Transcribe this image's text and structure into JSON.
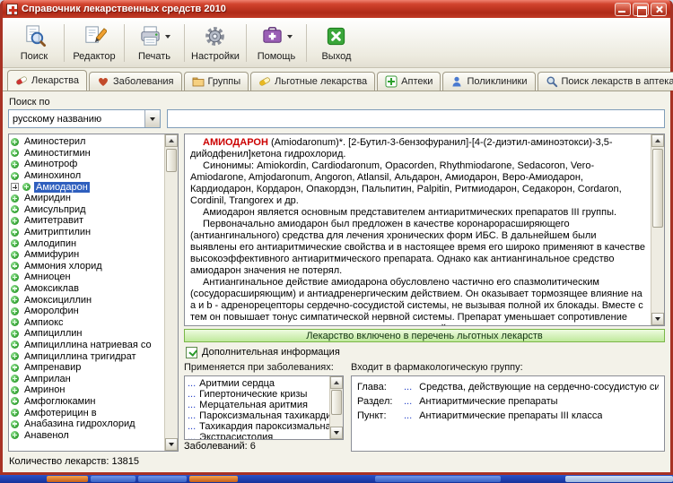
{
  "window": {
    "title": "Справочник лекарственных средств 2010"
  },
  "toolbar": {
    "buttons": [
      {
        "label": "Поиск",
        "icon": "search-icon"
      },
      {
        "label": "Редактор",
        "icon": "edit-icon"
      },
      {
        "label": "Печать",
        "icon": "print-icon",
        "dropdown": true
      },
      {
        "label": "Настройки",
        "icon": "gear-icon"
      },
      {
        "label": "Помощь",
        "icon": "help-kit-icon",
        "dropdown": true
      },
      {
        "label": "Выход",
        "icon": "exit-icon"
      }
    ]
  },
  "tabs": [
    {
      "label": "Лекарства",
      "icon": "pill-icon",
      "active": true
    },
    {
      "label": "Заболевания",
      "icon": "disease-icon"
    },
    {
      "label": "Группы",
      "icon": "folder-icon"
    },
    {
      "label": "Льготные лекарства",
      "icon": "benefit-pill-icon"
    },
    {
      "label": "Аптеки",
      "icon": "pharmacy-cross-icon"
    },
    {
      "label": "Поликлиники",
      "icon": "person-icon"
    },
    {
      "label": "Поиск лекарств в аптеках",
      "icon": "magnifier-icon"
    }
  ],
  "search": {
    "label": "Поиск по",
    "combo_value": "русскому названию",
    "input_value": ""
  },
  "drug_list": {
    "items": [
      {
        "label": "Аминостерил"
      },
      {
        "label": "Аминостигмин"
      },
      {
        "label": "Аминотроф"
      },
      {
        "label": "Аминохинол"
      },
      {
        "label": "Амиодарон",
        "cls": "selected",
        "expand": true
      },
      {
        "label": "Амиридин"
      },
      {
        "label": "Амисульприд"
      },
      {
        "label": "Амитетравит"
      },
      {
        "label": "Амитриптилин"
      },
      {
        "label": "Амлодипин"
      },
      {
        "label": "Аммифурин"
      },
      {
        "label": "Аммония хлорид"
      },
      {
        "label": "Амниоцен"
      },
      {
        "label": "Амоксиклав"
      },
      {
        "label": "Амоксициллин"
      },
      {
        "label": "Аморолфин"
      },
      {
        "label": "Ампиокс"
      },
      {
        "label": "Ампициллин"
      },
      {
        "label": "Ампициллина натриевая со"
      },
      {
        "label": "Ампициллина тригидрат"
      },
      {
        "label": "Ампренавир"
      },
      {
        "label": "Амприлан"
      },
      {
        "label": "Амринон"
      },
      {
        "label": "Амфоглюкамин"
      },
      {
        "label": "Амфотерицин в"
      },
      {
        "label": "Анабазина гидрохлорид"
      },
      {
        "label": "Анавенол"
      }
    ]
  },
  "status": {
    "count_label": "Количество лекарств: 13815"
  },
  "description": {
    "lead": "АМИОДАРОН",
    "lead_rest": " (Amiodaronum)*. [2-Бутил-3-бензофуранил]-[4-(2-диэтил-аминоэтокси)-3,5-дийодфенил]кетона гидрохлорид.",
    "paragraphs": [
      "Синонимы: Amiokordin, Cardiodaronum, Opacorden, Rhythmiodarone, Sedacoron, Vero-Amiodarone, Amjodaronum, Angoron, Atlansil, Альдарон, Амиодарон, Веро-Амиодарон, Кардиодарон, Кордарон, Опакордэн, Пальпитин, Palpitin, Ритмиодарон, Седакорон, Cordaron, Cordinil, Trangorex и др.",
      "Амиодарон является основным представителем антиаритмических препаратов III группы.",
      "Первоначально амиодарон был предложен в качестве коронарорасширяющего (антиангинального) средства для лечения хронических форм ИБС. В дальнейшем были выявлены его антиаритмические свойства и в настоящее время его широко применяют в качестве высокоэффективного антиаритмического препарата. Однако как антиангинальное средство амиодарон значения не потерял.",
      "Антиангинальное действие амиодарона обусловлено частично его спазмолитическим (сосудорасширяющим) и антиадренергическим действием. Он оказывает тормозящее влияние на a и b - адренорецепторы сердечно-сосудистой системы, не вызывая полной их блокады. Вместе с тем он повышает тонус симпатической нервной системы. Препарат уменьшает сопротивление коронарных сосудов сердца и увеличивает коронарный кровоток, урежает сердечные сокращения, уменьшает потребность миокарда в кислороде, способствует увеличению энергетических резервов миокарда"
    ]
  },
  "benefit_banner": "Лекарство включено в перечень льготных лекарств",
  "additional_info": {
    "label": "Дополнительная информация",
    "checked": true
  },
  "diseases": {
    "header": "Применяется при заболеваниях:",
    "items": [
      {
        "dots": "...",
        "name": "Аритмии сердца"
      },
      {
        "dots": "...",
        "name": "Гипертонические кризы"
      },
      {
        "dots": "...",
        "name": "Мерцательная аритмия"
      },
      {
        "dots": "...",
        "name": "Пароксизмальная тахикардия"
      },
      {
        "dots": "...",
        "name": "Тахикардия пароксизмальная"
      },
      {
        "dots": "...",
        "name": "Экстрасистолия"
      }
    ],
    "footer": "Заболеваний: 6"
  },
  "pharm_group": {
    "header": "Входит в фармакологическую группу:",
    "rows": [
      {
        "label": "Глава:",
        "dots": "...",
        "value": "Средства, действующие на сердечно-сосудистую систему"
      },
      {
        "label": "Раздел:",
        "dots": "...",
        "value": "Антиаритмические препараты"
      },
      {
        "label": "Пункт:",
        "dots": "...",
        "value": "Антиаритмические препараты III класса"
      }
    ]
  },
  "colors": {
    "titlebar_red": "#b02a18",
    "selection_blue": "#2f5fbe",
    "banner_green_border": "#7ab648",
    "link_blue": "#2440c8",
    "drug_name_red": "#cc0000",
    "list_icon_green": "#2d9b2d"
  }
}
